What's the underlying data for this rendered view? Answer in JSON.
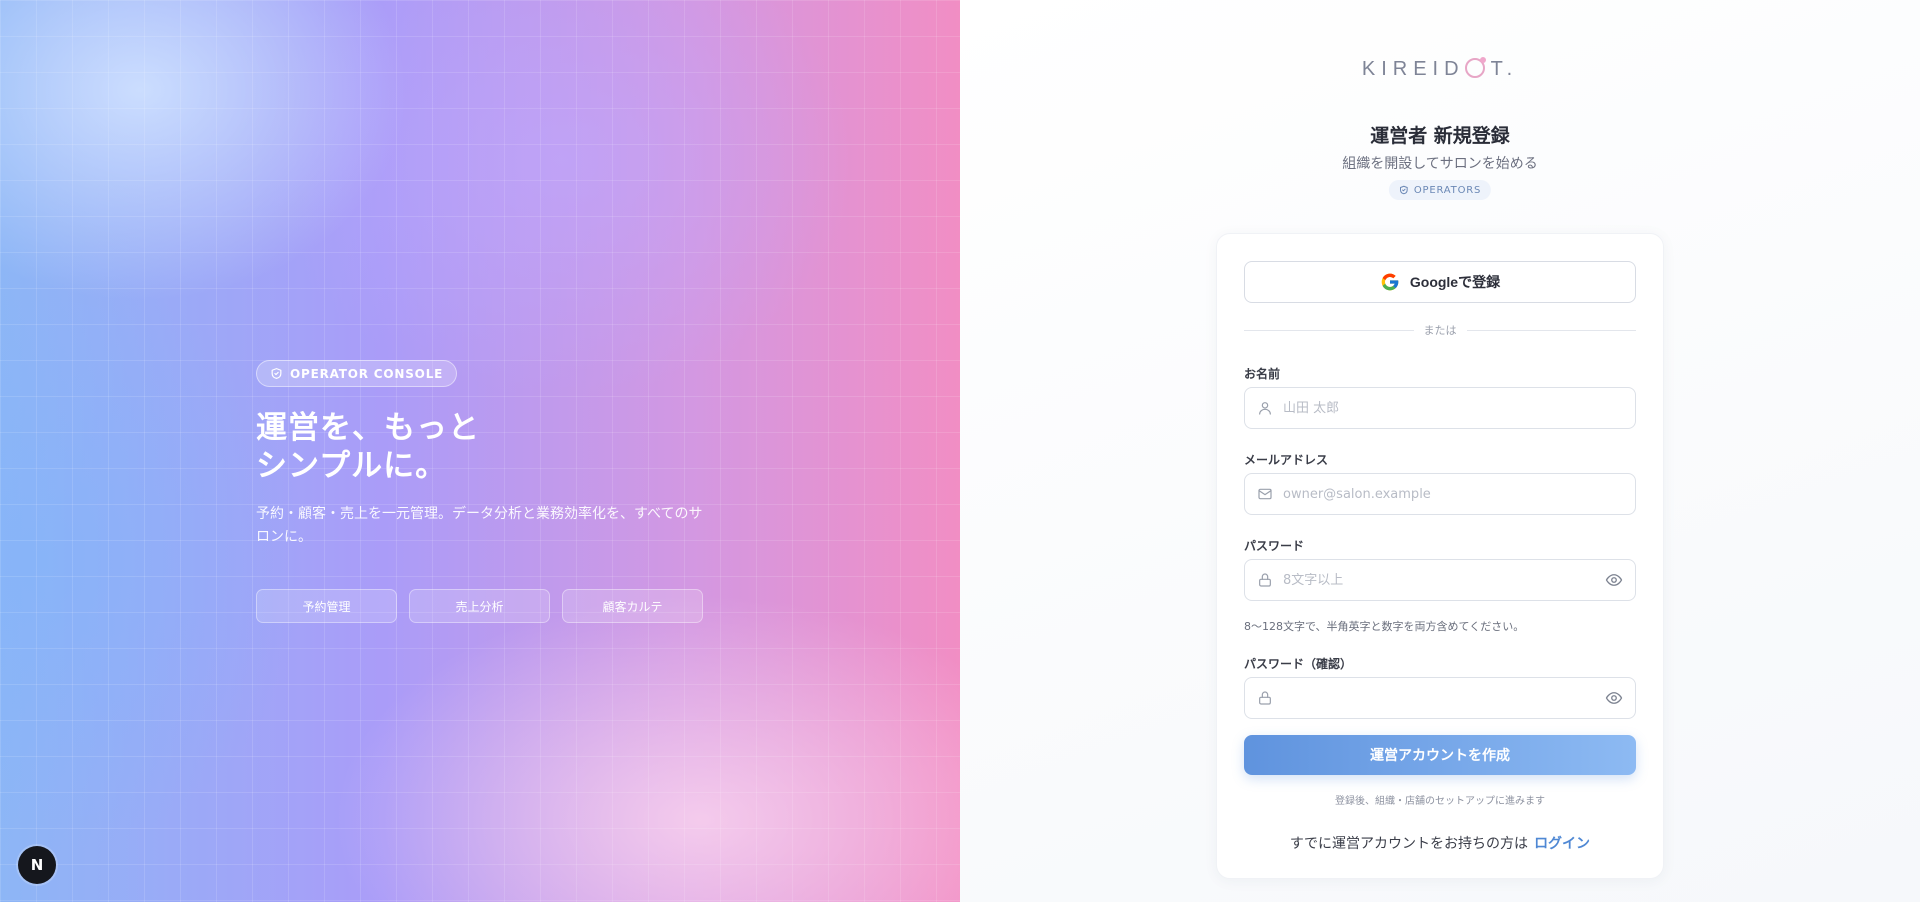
{
  "hero": {
    "badge": "OPERATOR CONSOLE",
    "title_line1": "運営を、もっと",
    "title_line2": "シンプルに。",
    "subtitle": "予約・顧客・売上を一元管理。データ分析と業務効率化を、すべてのサロンに。",
    "pills": [
      "予約管理",
      "売上分析",
      "顧客カルテ"
    ]
  },
  "framework_badge": "N",
  "brand": {
    "logo_prefix": "KIREID",
    "logo_suffix": "T."
  },
  "header": {
    "title": "運営者 新規登録",
    "subtitle": "組織を開設してサロンを始める",
    "badge": "OPERATORS"
  },
  "form": {
    "google_label": "Googleで登録",
    "divider": "または",
    "name_label": "お名前",
    "name_placeholder": "山田 太郎",
    "email_label": "メールアドレス",
    "email_placeholder": "owner@salon.example",
    "password_label": "パスワード",
    "password_placeholder": "8文字以上",
    "password_hint": "8〜128文字で、半角英字と数字を両方含めてください。",
    "confirm_label": "パスワード（確認）",
    "confirm_placeholder": "",
    "submit_label": "運営アカウントを作成",
    "after_note": "登録後、組織・店舗のセットアップに進みます",
    "login_prompt": "すでに運営アカウントをお持ちの方は",
    "login_link": "ログイン"
  },
  "colors": {
    "accent": "#5f93de",
    "link": "#4f88d4",
    "hero_left": "#8db6f6",
    "hero_right": "#f18ec4"
  }
}
